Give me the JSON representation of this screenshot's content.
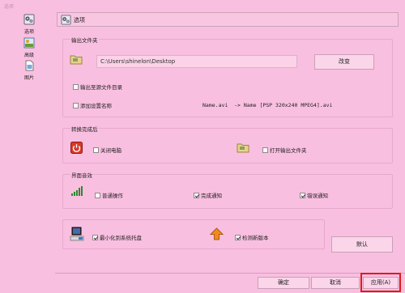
{
  "window": {
    "title": "选项"
  },
  "sidebar": {
    "items": [
      {
        "label": "选项",
        "icon": "gear-icon"
      },
      {
        "label": "高级",
        "icon": "gear-advanced-icon"
      },
      {
        "label": "图片",
        "icon": "picture-icon"
      }
    ]
  },
  "panel": {
    "title": "选项"
  },
  "output_folder": {
    "title": "输出文件夹",
    "path": "C:\\Users\\shinelon\\Desktop",
    "change_label": "改变",
    "save_to_source_label": "输出至源文件目录",
    "add_settings_name_label": "添加设置名称",
    "naming_example": "Name.avi  -> Name [PSP 320x240 MPEG4].avi"
  },
  "after_conversion": {
    "title": "转换完成后",
    "shutdown_label": "关闭电脑",
    "open_folder_label": "打开输出文件夹"
  },
  "interface_sound": {
    "title": "界面音效",
    "normal_op_label": "普通操作",
    "complete_notify_label": "完成通知",
    "complete_notify_checked": true,
    "error_notify_label": "错误通知",
    "error_notify_checked": true
  },
  "misc": {
    "minimize_tray_label": "最小化到系统托盘",
    "minimize_tray_checked": true,
    "check_update_label": "检测新版本",
    "check_update_checked": true,
    "default_label": "默认"
  },
  "footer": {
    "ok_label": "确定",
    "cancel_label": "取消",
    "apply_label": "应用(A)"
  },
  "colors": {
    "background": "#f9bfe0",
    "highlight": "#e01b1b"
  }
}
